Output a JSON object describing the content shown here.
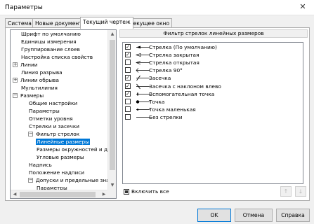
{
  "window": {
    "title": "Параметры",
    "close_glyph": "✕"
  },
  "tabs": [
    {
      "label": "Система",
      "active": false
    },
    {
      "label": "Новые документы",
      "active": false
    },
    {
      "label": "Текущий чертеж",
      "active": true
    },
    {
      "label": "Текущее окно",
      "active": false
    }
  ],
  "tree": {
    "items": [
      {
        "label": "Шрифт по умолчанию",
        "expander": ""
      },
      {
        "label": "Единицы измерения",
        "expander": ""
      },
      {
        "label": "Группирование слоев",
        "expander": ""
      },
      {
        "label": "Настройка списка свойств",
        "expander": ""
      },
      {
        "label": "Линии",
        "expander": "+"
      },
      {
        "label": "Линия разрыва",
        "expander": ""
      },
      {
        "label": "Линии обрыва",
        "expander": "+"
      },
      {
        "label": "Мультилиния",
        "expander": ""
      },
      {
        "label": "Размеры",
        "expander": "−"
      },
      {
        "label": "Общие настройки",
        "expander": ""
      },
      {
        "label": "Параметры",
        "expander": ""
      },
      {
        "label": "Отметки уровня",
        "expander": ""
      },
      {
        "label": "Стрелки и засечки",
        "expander": ""
      },
      {
        "label": "Фильтр стрелок",
        "expander": "−"
      },
      {
        "label": "Линейные размеры",
        "expander": "",
        "selected": true
      },
      {
        "label": "Размеры окружностей и дуг",
        "expander": ""
      },
      {
        "label": "Угловые размеры",
        "expander": ""
      },
      {
        "label": "Надпись",
        "expander": ""
      },
      {
        "label": "Положение надписи",
        "expander": ""
      },
      {
        "label": "Допуски и предельные значения",
        "expander": "−"
      },
      {
        "label": "Параметры",
        "expander": ""
      },
      {
        "label": "Допуски по умолчанию",
        "expander": ""
      }
    ]
  },
  "filter_panel": {
    "header": "Фильтр стрелок линейных размеров",
    "items": [
      {
        "label": "Стрелка  (По умолчанию)",
        "checked": true,
        "symbol": "arrow-filled-icon"
      },
      {
        "label": "Стрелка закрытая",
        "checked": true,
        "symbol": "arrow-closed-icon"
      },
      {
        "label": "Стрелка открытая",
        "checked": false,
        "symbol": "arrow-open-icon"
      },
      {
        "label": "Стрелка 90°",
        "checked": false,
        "symbol": "arrow-90-icon"
      },
      {
        "label": "Засечка",
        "checked": true,
        "symbol": "tick-icon"
      },
      {
        "label": "Засечка с наклоном влево",
        "checked": true,
        "symbol": "tick-left-icon"
      },
      {
        "label": "Вспомогательная точка",
        "checked": true,
        "symbol": "aux-point-icon"
      },
      {
        "label": "Точка",
        "checked": false,
        "symbol": "dot-icon"
      },
      {
        "label": "Точка маленькая",
        "checked": false,
        "symbol": "small-dot-icon"
      },
      {
        "label": "Без стрелки",
        "checked": false,
        "symbol": "no-arrow-icon"
      }
    ],
    "check_glyph": "✓",
    "enable_all_label": "Включить все",
    "move_up_glyph": "🡑",
    "move_down_glyph": "🡓"
  },
  "buttons": {
    "ok": "OK",
    "cancel": "Отмена",
    "help": "Справка"
  }
}
